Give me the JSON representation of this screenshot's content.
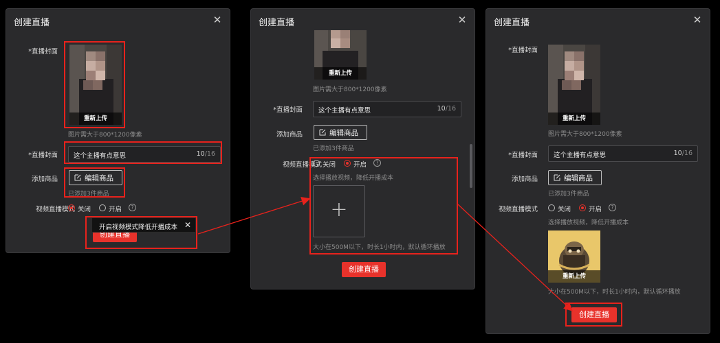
{
  "panels": [
    {
      "title": "创建直播",
      "close": "✕",
      "cover_label": "*直播封面",
      "cover_reupload": "重新上传",
      "cover_hint": "图片需大于800*1200像素",
      "title_label": "*直播封面",
      "title_value": "这个主播有点意思",
      "title_count": "10",
      "title_max": "/16",
      "goods_label": "添加商品",
      "goods_button": "编辑商品",
      "goods_hint": "已添加3件商品",
      "mode_label": "视频直播模式",
      "mode_off": "关闭",
      "mode_on": "开启",
      "mode_selected": "off",
      "help_glyph": "?",
      "tooltip_text": "开启视频模式降低开播成本",
      "tooltip_close": "✕",
      "create_button": "创建直播"
    },
    {
      "title": "创建直播",
      "close": "✕",
      "cover_reupload": "重新上传",
      "cover_hint": "图片需大于800*1200像素",
      "title_label": "*直播封面",
      "title_value": "这个主播有点意思",
      "title_count": "10",
      "title_max": "/16",
      "goods_label": "添加商品",
      "goods_button": "编辑商品",
      "goods_hint": "已添加3件商品",
      "mode_label": "视频直播模式",
      "mode_off": "关闭",
      "mode_on": "开启",
      "mode_selected": "on",
      "help_glyph": "?",
      "mode_hint": "选择播放视频，降低开播成本",
      "upload_plus": "+",
      "upload_hint": "大小在500M以下，时长1小时内，默认循环播放",
      "create_button": "创建直播"
    },
    {
      "title": "创建直播",
      "close": "✕",
      "cover_label": "*直播封面",
      "cover_reupload": "重新上传",
      "cover_hint": "图片需大于800*1200像素",
      "title_label": "*直播封面",
      "title_value": "这个主播有点意思",
      "title_count": "10",
      "title_max": "/16",
      "goods_label": "添加商品",
      "goods_button": "编辑商品",
      "goods_hint": "已添加3件商品",
      "mode_label": "视频直播模式",
      "mode_off": "关闭",
      "mode_on": "开启",
      "mode_selected": "on",
      "help_glyph": "?",
      "mode_hint": "选择播放视频，降低开播成本",
      "video_reupload": "重新上传",
      "upload_hint": "大小在500M以下，时长1小时内，默认循环播放",
      "create_button": "创建直播"
    }
  ],
  "colors": {
    "accent": "#e8322b",
    "highlight": "#e8221c",
    "dialog_bg": "#2a2a2c",
    "background": "#000000"
  },
  "icons": {
    "close": "close-icon",
    "edit": "edit-icon",
    "help": "help-icon",
    "upload": "plus-icon"
  }
}
